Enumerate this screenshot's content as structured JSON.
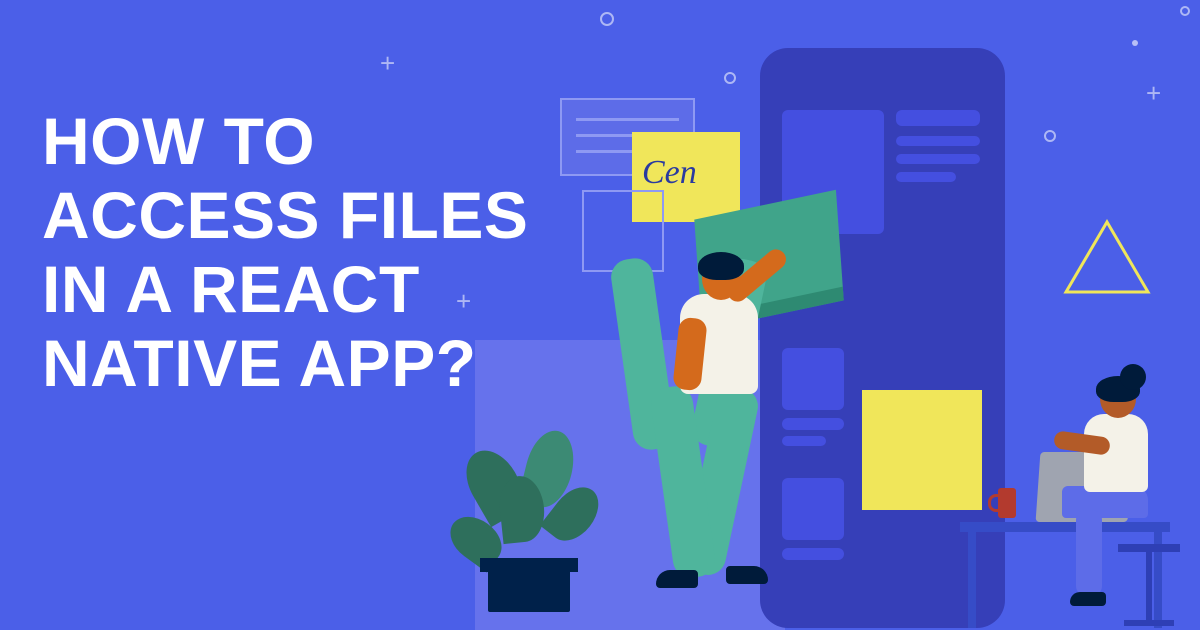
{
  "headline": "HOW TO ACCESS FILES IN A REACT NATIVE APP?",
  "signature_note": "Cen",
  "colors": {
    "background": "#4B5FE8",
    "phone": "#363FB8",
    "accent_yellow": "#F0E65A",
    "accent_green": "#40A48A",
    "dark_navy": "#001B3A"
  }
}
